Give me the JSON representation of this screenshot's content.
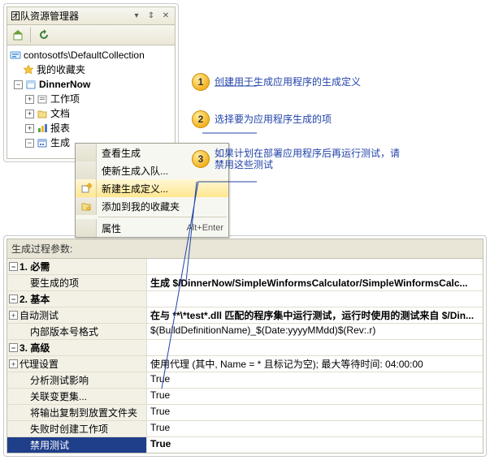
{
  "panel": {
    "title": "团队资源管理器",
    "root": "contosotfs\\DefaultCollection",
    "favorites": "我的收藏夹",
    "project": "DinnerNow",
    "nodes": {
      "work_items": "工作项",
      "documents": "文档",
      "reports": "报表",
      "builds": "生成"
    }
  },
  "context_menu": {
    "view_builds": "查看生成",
    "queue_new": "使新生成入队...",
    "new_build_def": "新建生成定义...",
    "add_fav": "添加到我的收藏夹",
    "properties": "属性",
    "shortcut": "Alt+Enter"
  },
  "callouts": {
    "c1": {
      "n": "1",
      "text": "创建用于生成应用程序的生成定义"
    },
    "c2": {
      "n": "2",
      "text": "选择要为应用程序生成的项"
    },
    "c3": {
      "n": "3",
      "text": "如果计划在部署应用程序后再运行测试，请禁用这些测试"
    }
  },
  "grid": {
    "title": "生成过程参数:",
    "cat1": "1. 必需",
    "items_to_build": {
      "label": "要生成的项",
      "value": "生成 $/DinnerNow/SimpleWinformsCalculator/SimpleWinformsCalc..."
    },
    "cat2": "2. 基本",
    "auto_tests": {
      "label": "自动测试",
      "value": "在与 **\\*test*.dll 匹配的程序集中运行测试，运行时使用的测试来自 $/Din..."
    },
    "build_num_fmt": {
      "label": "内部版本号格式",
      "value": "$(BuildDefinitionName)_$(Date:yyyyMMdd)$(Rev:.r)"
    },
    "cat3": "3. 高级",
    "agent": {
      "label": "代理设置",
      "value": "使用代理 (其中, Name = * 且标记为空); 最大等待时间: 04:00:00"
    },
    "analyze": {
      "label": "分析测试影响",
      "value": "True"
    },
    "assoc": {
      "label": "关联变更集...",
      "value": "True"
    },
    "copy_out": {
      "label": "将输出复制到放置文件夹",
      "value": "True"
    },
    "create_wi": {
      "label": "失败时创建工作项",
      "value": "True"
    },
    "disable_tests": {
      "label": "禁用测试",
      "value": "True"
    }
  }
}
